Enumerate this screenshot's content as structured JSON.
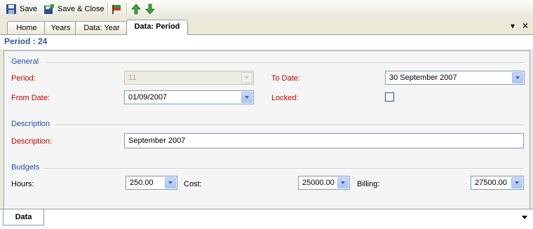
{
  "toolbar": {
    "save_label": "Save",
    "save_close_label": "Save & Close",
    "icons": [
      "floppy-disk-icon",
      "save-close-icon",
      "flag-icon",
      "arrow-up-icon",
      "arrow-down-icon"
    ]
  },
  "tabs": [
    {
      "label": "Home"
    },
    {
      "label": "Years"
    },
    {
      "label": "Data: Year"
    },
    {
      "label": "Data: Period",
      "active": true
    }
  ],
  "tab_controls": {
    "dropdown": "▾",
    "close": "✕"
  },
  "title": "Period : 24",
  "sections": {
    "general": "General",
    "description": "Description",
    "budgets": "Budgets"
  },
  "fields": {
    "period_label": "Period:",
    "period_value": "11",
    "to_date_label": "To Date:",
    "to_date_value": "30 September 2007",
    "from_date_label": "From Date:",
    "from_date_value": "01/09/2007",
    "locked_label": "Locked:",
    "description_label": "Description:",
    "description_value": "September 2007",
    "hours_label": "Hours:",
    "hours_value": "250.00",
    "cost_label": "Cost:",
    "cost_value": "25000.00",
    "billing_label": "Billing:",
    "billing_value": "27500.00"
  },
  "bottom_tab": "Data",
  "colors": {
    "accent": "#1e50a2",
    "required": "#c00000",
    "border": "#7f9db9"
  }
}
